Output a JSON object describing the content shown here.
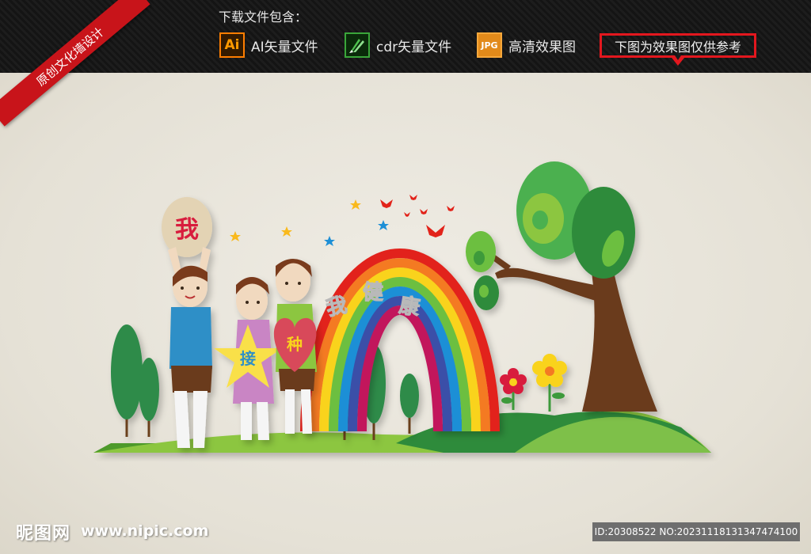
{
  "header": {
    "title": "下载文件包含：",
    "files": [
      {
        "icon": "ai-file-icon",
        "badge": "Ai",
        "label": "AI矢量文件"
      },
      {
        "icon": "cdr-file-icon",
        "badge": "",
        "label": "cdr矢量文件"
      },
      {
        "icon": "jpg-file-icon",
        "badge": "JPG",
        "label": "高清效果图"
      }
    ],
    "notice": "下图为效果图仅供参考"
  },
  "ribbon": {
    "label": "原创文化墙设计"
  },
  "artwork": {
    "head_sign": "我",
    "star_sign": "接",
    "heart_sign": "种",
    "rainbow_title": [
      "我",
      "健",
      "康"
    ]
  },
  "footer": {
    "logo": "昵图网",
    "url": "www.nipic.com",
    "id_text": "ID:20308522 NO:20231118131347474100"
  },
  "colors": {
    "accent_red": "#e3171e",
    "ai_orange": "#ff7e00",
    "cdr_green": "#3aa63a",
    "jpg_orange": "#f7a83b"
  }
}
